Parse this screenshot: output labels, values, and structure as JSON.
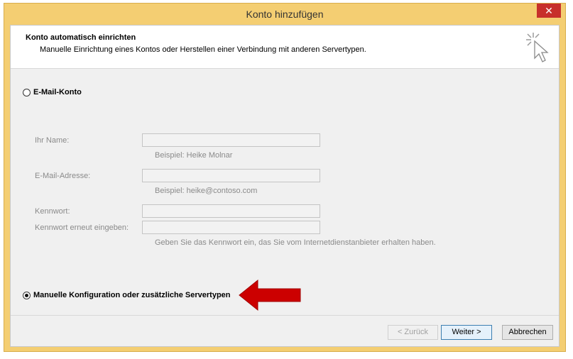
{
  "window": {
    "title": "Konto hinzufügen",
    "close_glyph": "✕"
  },
  "header": {
    "title": "Konto automatisch einrichten",
    "subtitle": "Manuelle Einrichtung eines Kontos oder Herstellen einer Verbindung mit anderen Servertypen.",
    "icon": "wizard-cursor-icon"
  },
  "options": {
    "email_account": {
      "label": "E-Mail-Konto",
      "selected": false
    },
    "manual": {
      "label": "Manuelle Konfiguration oder zusätzliche Servertypen",
      "selected": true
    }
  },
  "form": {
    "name_label": "Ihr Name:",
    "name_value": "",
    "name_hint": "Beispiel: Heike Molnar",
    "email_label": "E-Mail-Adresse:",
    "email_value": "",
    "email_hint": "Beispiel: heike@contoso.com",
    "password_label": "Kennwort:",
    "password_value": "",
    "password_repeat_label": "Kennwort erneut eingeben:",
    "password_repeat_value": "",
    "password_hint": "Geben Sie das Kennwort ein, das Sie vom Internetdienstanbieter erhalten haben."
  },
  "buttons": {
    "back": "< Zurück",
    "next": "Weiter >",
    "cancel": "Abbrechen"
  },
  "colors": {
    "arrow": "#cc0000",
    "titlebar": "#f4ce72",
    "close": "#c7302b"
  }
}
